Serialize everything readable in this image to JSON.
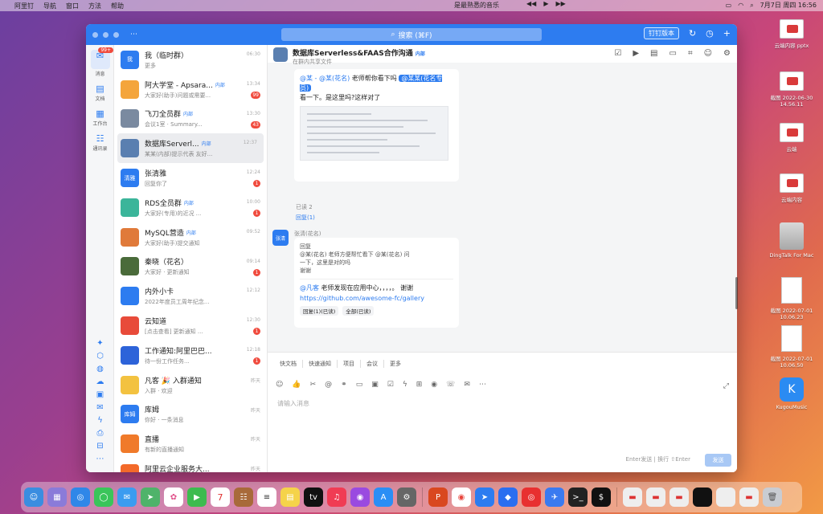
{
  "menubar": {
    "apple": "",
    "items": [
      "阿里钉",
      "导航",
      "窗口",
      "方法",
      "帮助"
    ],
    "center_text": "是最熟悉的音乐",
    "status_text": "99+",
    "datetime": "7月7日 周四 16:56"
  },
  "window": {
    "back_label": "⋯",
    "search_placeholder": "搜索 (⌘F)",
    "header_button": "钉钉版本",
    "add_icon": "+"
  },
  "nav": {
    "items": [
      {
        "label": "消息",
        "icon": "message-icon",
        "badge": "99+"
      },
      {
        "label": "文档",
        "icon": "doc-icon"
      },
      {
        "label": "工作台",
        "icon": "workbench-icon"
      },
      {
        "label": "通讯录",
        "icon": "contacts-icon"
      }
    ]
  },
  "conversations": [
    {
      "name": "我（临时群）",
      "sub": "更多",
      "time": "06:30",
      "avatar_text": "我",
      "color": "#2d7cf0"
    },
    {
      "name": "阿大学堂 - Apsara...",
      "tag": "内部",
      "sub": "大家好(助手)问题或需要...",
      "time": "13:34",
      "badge": "99",
      "avatar_text": "",
      "color": "#f4a53c"
    },
    {
      "name": "飞刀全员群",
      "tag": "内部",
      "sub": "会议1室 · Summary...",
      "time": "13:30",
      "badge": "43",
      "avatar_text": "",
      "color": "#7a8aa0"
    },
    {
      "name": "数据库Serverl...",
      "tag": "内部",
      "sub": "某某(内部)提示代表 友好...",
      "time": "12:37",
      "avatar_text": "",
      "color": "#5a7fb0",
      "selected": true
    },
    {
      "name": "张清雅",
      "sub": "回复你了",
      "time": "12:24",
      "badge": "1",
      "avatar_text": "清雅",
      "color": "#2d7cf0"
    },
    {
      "name": "RDS全员群",
      "tag": "内部",
      "sub": "大家好(专用)的近况 ...",
      "time": "10:00",
      "badge": "1",
      "avatar_text": "",
      "color": "#3bb59a"
    },
    {
      "name": "MySQL营造",
      "tag": "内部",
      "sub": "大家好(助手)提交通知",
      "time": "09:52",
      "avatar_text": "",
      "color": "#e07a3a"
    },
    {
      "name": "秦晓（花名）",
      "sub": "大家好 · 更新通知",
      "time": "09:14",
      "badge": "1",
      "avatar_text": "",
      "color": "#4a6b3a"
    },
    {
      "name": "内外小卡",
      "sub": "2022年度员工周年纪念...",
      "time": "12:12",
      "avatar_text": "",
      "color": "#2d7cf0"
    },
    {
      "name": "云知道",
      "sub": "[点击查看] 更新通知 ...",
      "time": "12:30",
      "badge": "1",
      "avatar_text": "",
      "color": "#e84b3a"
    },
    {
      "name": "工作通知:阿里巴巴...",
      "sub": "待一份工作任务...",
      "time": "12:18",
      "badge": "1",
      "avatar_text": "",
      "color": "#2d63d9"
    },
    {
      "name": "凡客 🎉 入群通知",
      "sub": "入群 · 欢迎",
      "time": "昨天",
      "avatar_text": "",
      "color": "#f3c240"
    },
    {
      "name": "库姆",
      "sub": "你好 · 一条消息",
      "time": "昨天",
      "avatar_text": "库姆",
      "color": "#2d7cf0"
    },
    {
      "name": "直播",
      "sub": "有新的直播通知",
      "time": "昨天",
      "avatar_text": "",
      "color": "#f07a2a"
    },
    {
      "name": "阿里云企业服务大...",
      "sub": "阿里云企业服务 | 更新...",
      "time": "昨天",
      "avatar_text": "",
      "color": "#f36a2a"
    }
  ],
  "chat": {
    "title": "数据库Serverless&FAAS合作沟通",
    "title_tag": "内部",
    "subtitle": "在群内共享文件",
    "msg1_prefix": "@某 - @某(花名)",
    "msg1_mid": "老师帮你看下吗",
    "msg1_pill": "@某某(花名专员)",
    "msg1_line2": "看一下。是这里吗?这样对了",
    "msg1_read": "已读 2",
    "msg1_reply": "回复(1)",
    "sender2": "张清(花名)",
    "msg2_lines": [
      "回复",
      "@某(花名) 老师方便帮忙看下 @某(花名) 问",
      "一下，这里是对的吗",
      "谢谢"
    ],
    "msg2_mention": "@凡客",
    "msg2_text": "老师发现在应用中心，，，，。 谢谢",
    "msg2_link": "https://github.com/awesome-fc/gallery",
    "msg2_chip1": "回复(1)(已读)",
    "msg2_chip2": "全部(已读)"
  },
  "toolbar": [
    "快文档",
    "快速通知",
    "项目",
    "会议",
    "更多"
  ],
  "compose": {
    "placeholder": "请输入消息",
    "hint": "Enter发送 | 换行 ⇧Enter",
    "send": "发送"
  },
  "desktop": [
    {
      "label": "云端内容 pptx",
      "kind": "file"
    },
    {
      "label": "截图 2022-06-30 14.56.11",
      "kind": "file"
    },
    {
      "label": "云端",
      "kind": "file"
    },
    {
      "label": "云端内容",
      "kind": "file"
    },
    {
      "label": "DingTalk For Mac",
      "kind": "hd"
    },
    {
      "label": "截图 2022-07-01 10.06.23",
      "kind": "doc"
    },
    {
      "label": "截图 2022-07-01 10.06.50",
      "kind": "doc"
    },
    {
      "label": "KugouMusic",
      "kind": "kugou"
    }
  ]
}
